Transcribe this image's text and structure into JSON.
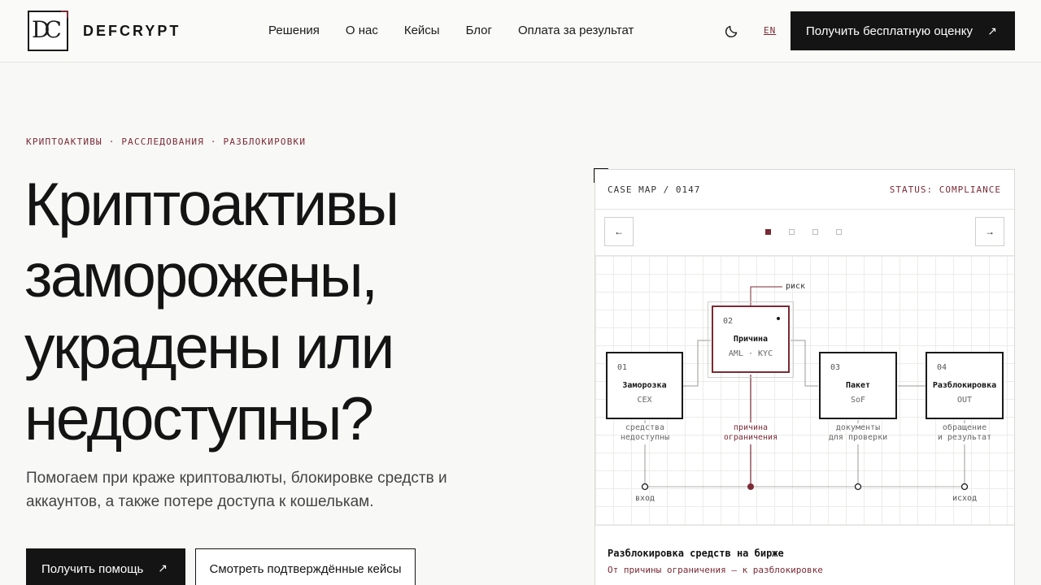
{
  "brand": {
    "logo_letters": "DC",
    "name": "DEFCRYPT"
  },
  "nav": {
    "items": [
      "Решения",
      "О нас",
      "Кейсы",
      "Блог",
      "Оплата за результат"
    ],
    "lang": "EN",
    "cta": "Получить бесплатную оценку",
    "cta_icon": "arrow-up-right-icon",
    "theme_icon": "moon-icon"
  },
  "hero": {
    "kicker": "КРИПТОАКТИВЫ · РАССЛЕДОВАНИЯ · РАЗБЛОКИРОВКИ",
    "headline_lines": [
      "Криптоактивы",
      "заморожены,",
      "украдены или",
      "недоступны?"
    ],
    "subtitle": "Помогаем при краже криптовалюты, блокировке средств и аккаунтов, а также потере доступа к кошелькам.",
    "primary_button": "Получить помощь",
    "secondary_button": "Смотреть подтверждённые кейсы"
  },
  "case_map": {
    "id": "CASE MAP / 0147",
    "status": "STATUS: COMPLIANCE",
    "prev": "←",
    "next": "→",
    "slides_total": 4,
    "slide_active": 1,
    "risk_label": "риск",
    "nodes": [
      {
        "num": "01",
        "title": "Заморозка",
        "code": "CEX",
        "caption": [
          "средства",
          "недоступны"
        ]
      },
      {
        "num": "02",
        "title": "Причина",
        "code": "AML · KYC",
        "caption": [
          "причина",
          "ограничения"
        ]
      },
      {
        "num": "03",
        "title": "Пакет",
        "code": "SoF",
        "caption": [
          "документы",
          "для проверки"
        ]
      },
      {
        "num": "04",
        "title": "Разблокировка",
        "code": "OUT",
        "caption": [
          "обращение",
          "и результат"
        ]
      }
    ],
    "timeline_start": "вход",
    "timeline_end": "исход",
    "footer_title": "Разблокировка средств на бирже",
    "footer_subtitle": "От причины ограничения — к разблокировке",
    "accent_color": "#7a2a35"
  }
}
